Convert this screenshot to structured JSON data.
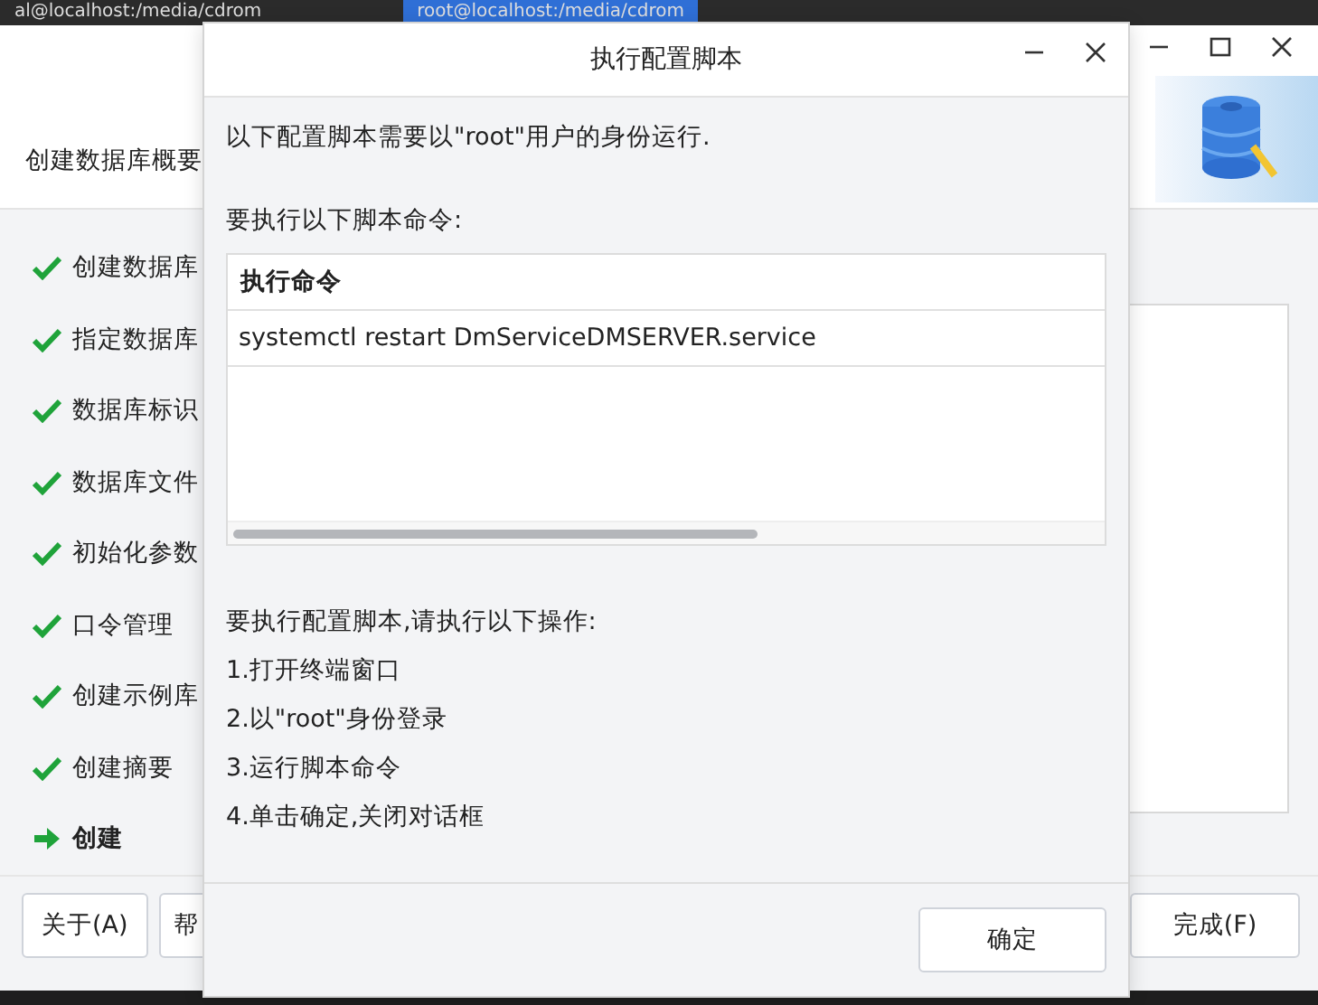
{
  "terminal_tabs": [
    {
      "label": "al@localhost:/media/cdrom",
      "selected": false
    },
    {
      "label": "root@localhost:/media/cdrom",
      "selected": true
    }
  ],
  "wizard": {
    "heading": "创建数据库概要",
    "steps": [
      {
        "label": "创建数据库",
        "done": true,
        "selected": false
      },
      {
        "label": "指定数据库",
        "done": true,
        "selected": false
      },
      {
        "label": "数据库标识",
        "done": true,
        "selected": false
      },
      {
        "label": "数据库文件",
        "done": true,
        "selected": false
      },
      {
        "label": "初始化参数",
        "done": true,
        "selected": false
      },
      {
        "label": "口令管理",
        "done": true,
        "selected": false
      },
      {
        "label": "创建示例库",
        "done": true,
        "selected": false
      },
      {
        "label": "创建摘要",
        "done": true,
        "selected": false
      },
      {
        "label": "创建",
        "done": false,
        "selected": true
      }
    ],
    "buttons_left": [
      "关于(A)",
      "帮"
    ],
    "finish_button": "完成(F)"
  },
  "dialog": {
    "title": "执行配置脚本",
    "intro": "以下配置脚本需要以\"root\"用户的身份运行.",
    "commands_label": "要执行以下脚本命令:",
    "table": {
      "columns": [
        "执行命令"
      ],
      "rows": [
        [
          "systemctl restart DmServiceDMSERVER.service"
        ]
      ]
    },
    "steps_heading": "要执行配置脚本,请执行以下操作:",
    "steps": [
      "1.打开终端窗口",
      "2.以\"root\"身份登录",
      "3.运行脚本命令",
      "4.单击确定,关闭对话框"
    ],
    "ok_button": "确定"
  }
}
